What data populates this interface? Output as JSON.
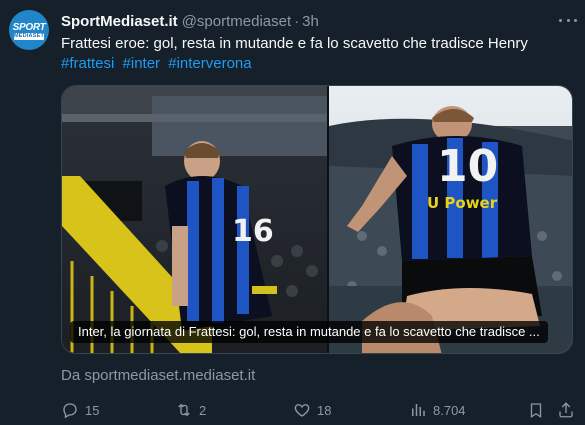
{
  "author": {
    "display_name": "SportMediaset.it",
    "handle": "@sportmediaset",
    "separator": "·",
    "time": "3h",
    "avatar_top": "SPORT",
    "avatar_bottom": "MEDIASET"
  },
  "tweet": {
    "text": "Frattesi eroe: gol, resta in mutande e fa lo scavetto che tradisce Henry",
    "hashtags": [
      "#frattesi",
      "#inter",
      "#interverona"
    ]
  },
  "card": {
    "title": "Inter, la giornata di Frattesi: gol, resta in mutande e fa lo scavetto che tradisce ...",
    "source": "Da sportmediaset.mediaset.it"
  },
  "metrics": {
    "replies": "15",
    "reposts": "2",
    "likes": "18",
    "views": "8.704"
  },
  "colors": {
    "background": "#15202b",
    "accent": "#1d9bf0",
    "muted": "#8b98a5"
  },
  "icons": [
    "more-icon",
    "reply-icon",
    "repost-icon",
    "like-icon",
    "views-icon",
    "bookmark-icon",
    "share-icon"
  ]
}
